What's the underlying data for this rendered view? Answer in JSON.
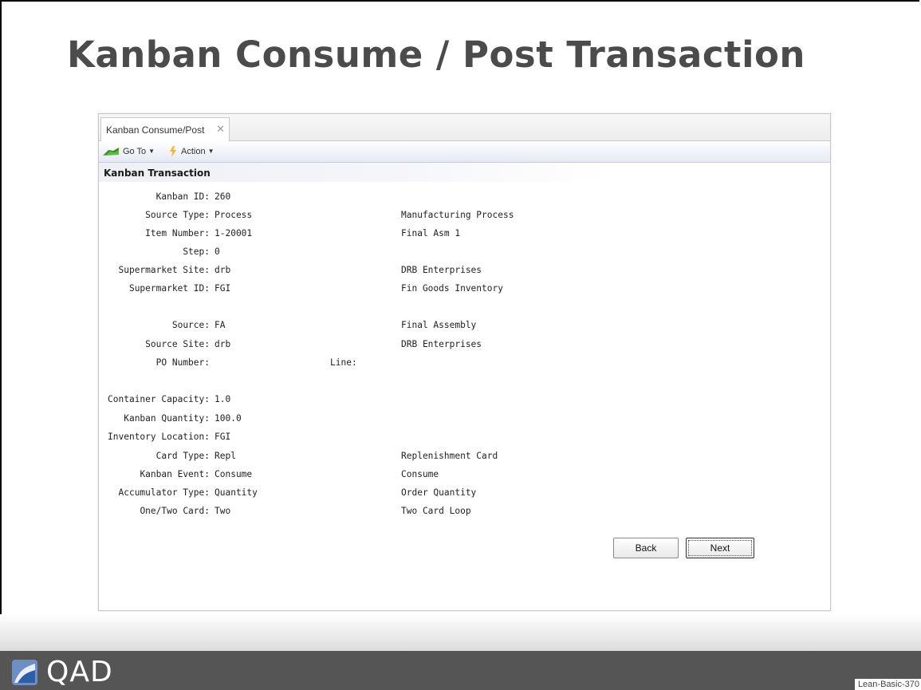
{
  "slide": {
    "title": "Kanban Consume / Post Transaction",
    "brand": "QAD",
    "slide_code": "Lean-Basic-370"
  },
  "app": {
    "tab_label": "Kanban Consume/Post",
    "tab_close": "✕",
    "toolbar": {
      "goto_label": "Go To",
      "action_label": "Action"
    },
    "section_title": "Kanban Transaction",
    "fields": [
      {
        "label": "Kanban ID:",
        "value": "260",
        "desc": ""
      },
      {
        "label": "Source Type:",
        "value": "Process",
        "desc": "Manufacturing Process"
      },
      {
        "label": "Item Number:",
        "value": "1-20001",
        "desc": "Final Asm 1"
      },
      {
        "label": "Step:",
        "value": "0",
        "desc": ""
      },
      {
        "label": "Supermarket Site:",
        "value": "drb",
        "desc": "DRB Enterprises"
      },
      {
        "label": "Supermarket ID:",
        "value": "FGI",
        "desc": "Fin Goods Inventory"
      },
      {
        "label": "Source:",
        "value": "FA",
        "desc": "Final Assembly"
      },
      {
        "label": "Source Site:",
        "value": "drb",
        "desc": "DRB Enterprises"
      },
      {
        "label": "PO Number:",
        "value": "",
        "desc": "",
        "line_label": "Line:"
      },
      {
        "label": "Container Capacity:",
        "value": "1.0",
        "desc": ""
      },
      {
        "label": "Kanban Quantity:",
        "value": "100.0",
        "desc": ""
      },
      {
        "label": "Inventory Location:",
        "value": "FGI",
        "desc": ""
      },
      {
        "label": "Card Type:",
        "value": "Repl",
        "desc": "Replenishment Card"
      },
      {
        "label": "Kanban Event:",
        "value": "Consume",
        "desc": "Consume"
      },
      {
        "label": "Accumulator Type:",
        "value": "Quantity",
        "desc": "Order Quantity"
      },
      {
        "label": "One/Two Card:",
        "value": "Two",
        "desc": "Two Card Loop"
      }
    ],
    "buttons": {
      "back_label": "Back",
      "next_label": "Next"
    }
  },
  "icons": {
    "goto": "green-arrow-icon",
    "action": "lightning-icon",
    "dropdown": "chevron-down-icon",
    "logo": "qad-logo-icon"
  },
  "colors": {
    "title": "#4b4b4b",
    "footer": "#555555",
    "toolbar_gradient_end": "#e4e9f3"
  }
}
